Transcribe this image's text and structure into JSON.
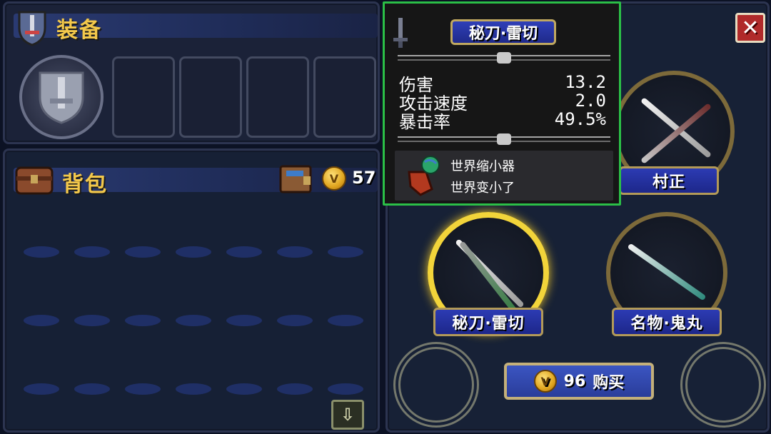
{
  "equipment": {
    "title": "装备",
    "icon": "sword-shield-icon"
  },
  "backpack": {
    "title": "背包",
    "icon": "chest-icon",
    "wallet_icon": "wallet-icon",
    "coins": "57"
  },
  "shop": {
    "items": [
      {
        "name": "秘刀·雷切",
        "selected": true
      },
      {
        "name": "名物·鬼丸",
        "selected": false
      },
      {
        "name": "村正",
        "selected": false
      }
    ],
    "buy": {
      "price": "96",
      "label": "购买"
    }
  },
  "tooltip": {
    "title": "秘刀·雷切",
    "stats": [
      {
        "label": "伤害",
        "value": "13.2"
      },
      {
        "label": "攻击速度",
        "value": "2.0"
      },
      {
        "label": "暴击率",
        "value": "49.5%"
      }
    ],
    "effect_name": "世界缩小器",
    "effect_desc": "世界变小了",
    "effect_icon": "globe-icon"
  },
  "colors": {
    "accent_gold": "#f3c84b",
    "tooltip_border": "#2bbf47",
    "close_red": "#b02a2a"
  }
}
